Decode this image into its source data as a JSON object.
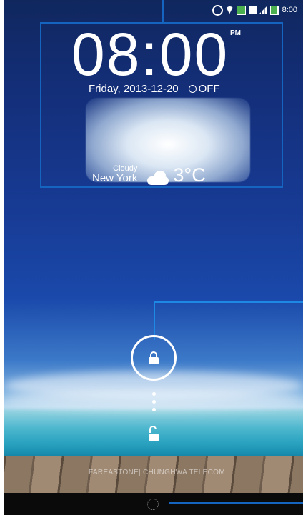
{
  "status_bar": {
    "time": "8:00",
    "icons": [
      "rotation-icon",
      "wifi-icon",
      "notification-icon",
      "sim-icon",
      "signal-icon",
      "battery-icon"
    ]
  },
  "clock_widget": {
    "time": "08:00",
    "ampm": "PM",
    "date": "Friday, 2013-12-20",
    "alarm": "OFF"
  },
  "weather": {
    "condition": "Cloudy",
    "city": "New York",
    "temperature": "3°C"
  },
  "watermark": "FAREASTONE| CHUNGHWA TELECOM",
  "colors": {
    "callout": "#1565c0"
  }
}
